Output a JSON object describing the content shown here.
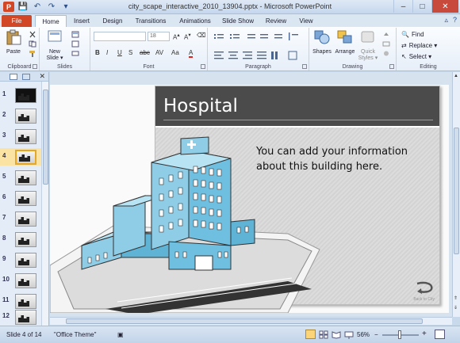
{
  "window": {
    "title": "city_scape_interactive_2010_13904.pptx - Microsoft PowerPoint",
    "minimize": "–",
    "maximize": "□",
    "close": "✕"
  },
  "quick_access": {
    "app_icon": "P",
    "save": "💾",
    "undo": "↶",
    "redo": "↷",
    "customize": "▾"
  },
  "tabs": [
    "File",
    "Home",
    "Insert",
    "Design",
    "Transitions",
    "Animations",
    "Slide Show",
    "Review",
    "View"
  ],
  "active_tab": "Home",
  "tab_right": {
    "collapse": "▵",
    "help": "?"
  },
  "ribbon": {
    "clipboard": {
      "label": "Clipboard",
      "paste": "Paste"
    },
    "slides": {
      "label": "Slides",
      "new_slide_line1": "New",
      "new_slide_line2": "Slide ▾"
    },
    "font": {
      "label": "Font",
      "size": "18",
      "bold": "B",
      "italic": "I",
      "underline": "U",
      "strike": "S",
      "abc": "abc",
      "av": "AV",
      "aa": "Aa",
      "color": "A"
    },
    "paragraph": {
      "label": "Paragraph"
    },
    "drawing": {
      "label": "Drawing",
      "shapes": "Shapes",
      "arrange": "Arrange",
      "quick_styles_line1": "Quick",
      "quick_styles_line2": "Styles ▾"
    },
    "editing": {
      "label": "Editing",
      "find": "Find",
      "replace": "Replace ▾",
      "select": "Select ▾"
    }
  },
  "slides_panel": {
    "items": [
      {
        "num": "1"
      },
      {
        "num": "2"
      },
      {
        "num": "3"
      },
      {
        "num": "4"
      },
      {
        "num": "5"
      },
      {
        "num": "6"
      },
      {
        "num": "7"
      },
      {
        "num": "8"
      },
      {
        "num": "9"
      },
      {
        "num": "10"
      },
      {
        "num": "11"
      },
      {
        "num": "12"
      }
    ],
    "selected": "4"
  },
  "slide": {
    "title": "Hospital",
    "body": "You can add your information about this building here.",
    "back_label": "Back to City"
  },
  "status": {
    "slide_info": "Slide 4 of 14",
    "theme": "\"Office Theme\"",
    "zoom": "56%",
    "zoom_minus": "−",
    "zoom_plus": "+"
  },
  "colors": {
    "file_tab": "#d24726",
    "title_bar_slide": "#4b4b4b",
    "building": "#8fcde6",
    "selected_thumb": "#fbe3a3"
  }
}
